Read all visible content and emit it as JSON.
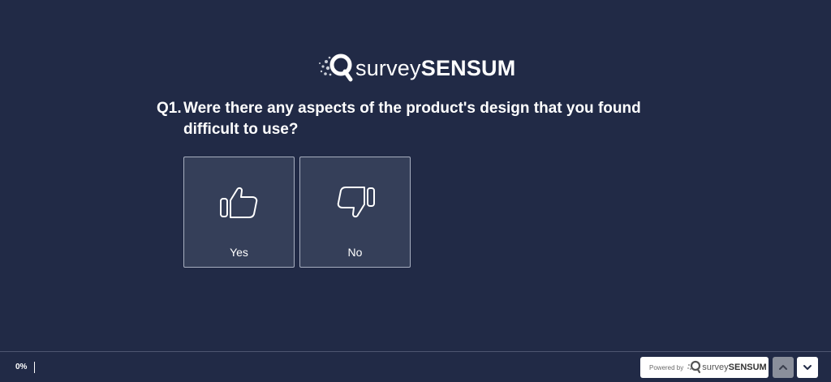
{
  "brand": {
    "logo_light": "survey",
    "logo_bold": "SENSUM"
  },
  "question": {
    "number": "Q1.",
    "text": "Were there any aspects of the product's design that you found difficult to use?"
  },
  "choices": [
    {
      "label": "Yes",
      "icon": "thumbs-up-icon"
    },
    {
      "label": "No",
      "icon": "thumbs-down-icon"
    }
  ],
  "footer": {
    "progress_text": "0%",
    "progress_value": 0,
    "powered_by": "Powered by",
    "mini_logo_light": "survey",
    "mini_logo_bold": "SENSUM",
    "prev_icon": "chevron-up-icon",
    "next_icon": "chevron-down-icon"
  },
  "colors": {
    "background": "#212a46",
    "choice_bg": "#353f59",
    "choice_border": "#a7aebf"
  }
}
